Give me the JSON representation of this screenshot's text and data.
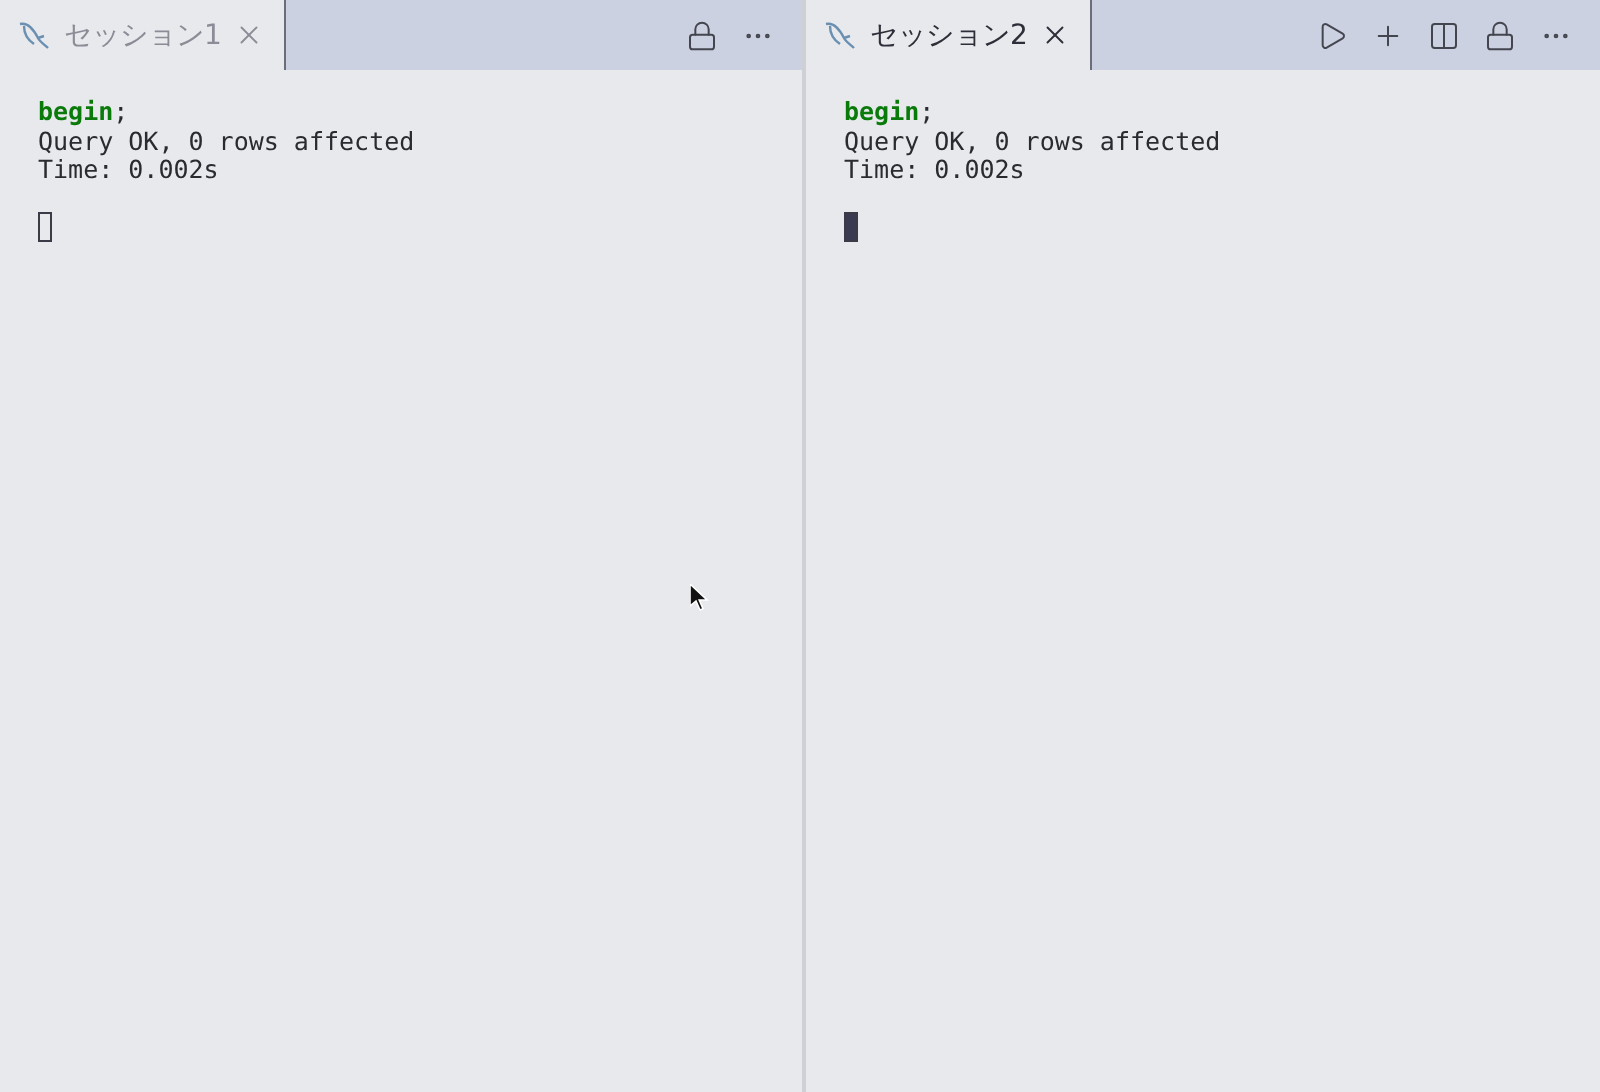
{
  "panes": [
    {
      "focused": false,
      "pointer": true,
      "tab": {
        "title": "セッション1"
      },
      "actions": [
        {
          "kind": "lock"
        },
        {
          "kind": "more"
        }
      ],
      "output": [
        "**begin**;",
        "Query OK, 0 rows affected",
        "Time: 0.002s"
      ]
    },
    {
      "focused": true,
      "tab": {
        "title": "セッション2"
      },
      "actions": [
        {
          "kind": "run"
        },
        {
          "kind": "add"
        },
        {
          "kind": "split"
        },
        {
          "kind": "lock"
        },
        {
          "kind": "more"
        }
      ],
      "output": [
        "**begin**;",
        "Query OK, 0 rows affected",
        "Time: 0.002s"
      ]
    }
  ]
}
